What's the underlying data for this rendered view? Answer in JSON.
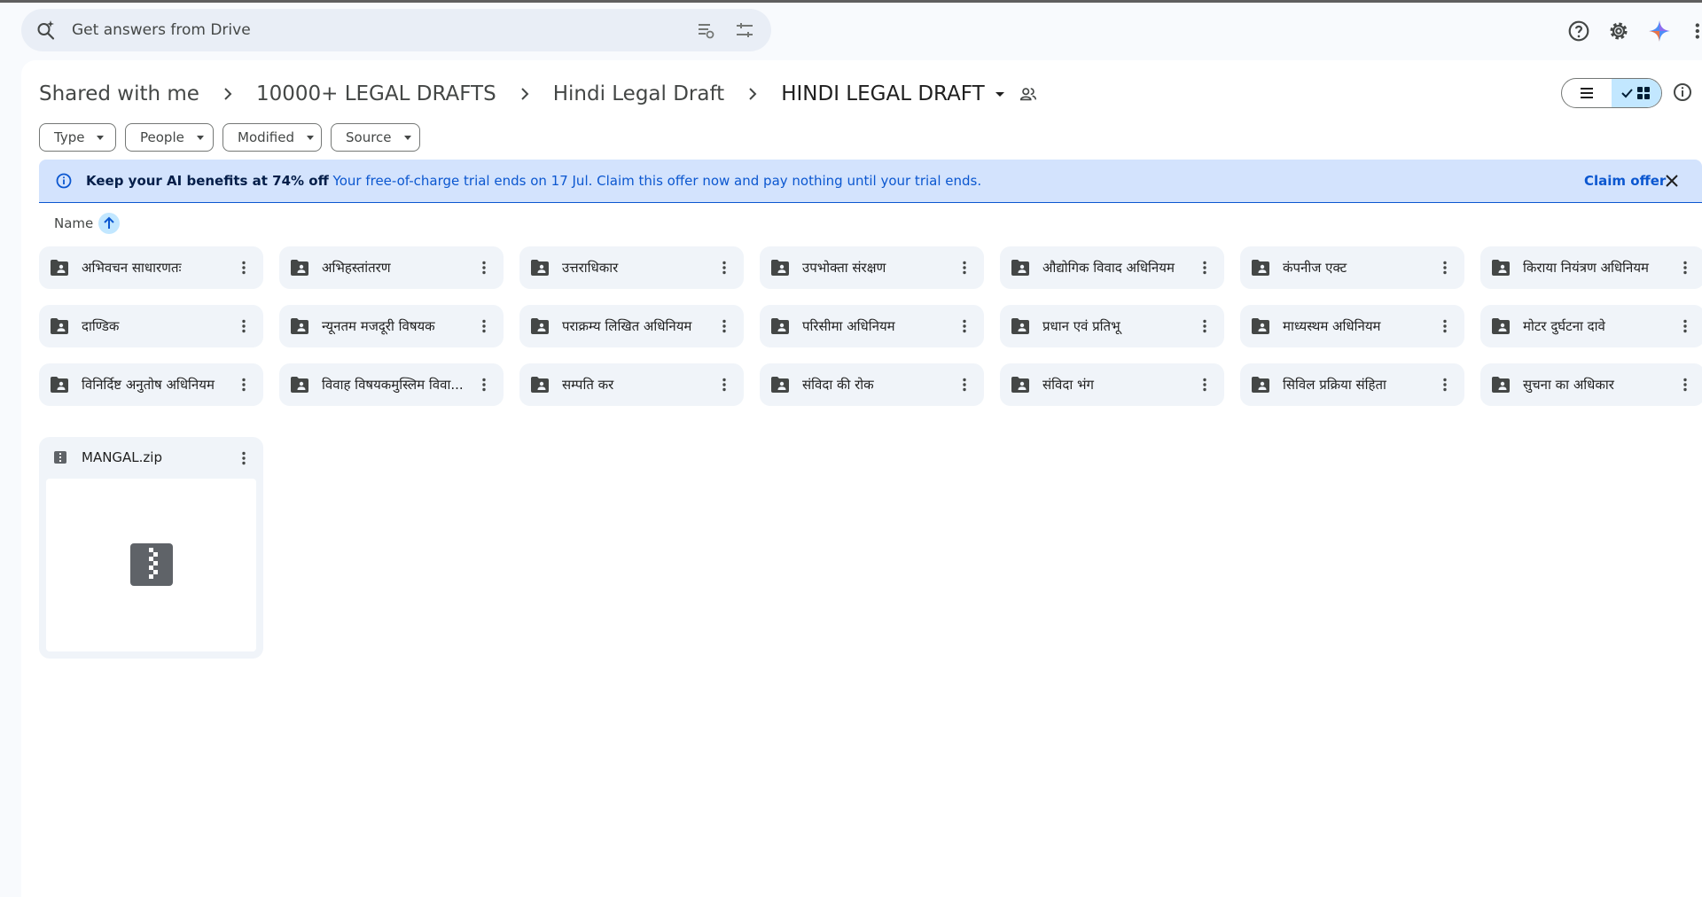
{
  "search": {
    "placeholder": "Get answers from Drive"
  },
  "breadcrumb": [
    {
      "label": "Shared with me"
    },
    {
      "label": "10000+ LEGAL DRAFTS"
    },
    {
      "label": "Hindi Legal Draft"
    },
    {
      "label": "HINDI LEGAL DRAFT"
    }
  ],
  "filters": [
    {
      "label": "Type"
    },
    {
      "label": "People"
    },
    {
      "label": "Modified"
    },
    {
      "label": "Source"
    }
  ],
  "banner": {
    "bold": "Keep your AI benefits at 74% off",
    "text": "Your free-of-charge trial ends on 17 Jul. Claim this offer now and pay nothing until your trial ends.",
    "cta": "Claim offer"
  },
  "sort": {
    "label": "Name"
  },
  "folders": [
    {
      "label": "अभिवचन साधारणतः"
    },
    {
      "label": "अभिहस्तांतरण"
    },
    {
      "label": "उत्तराधिकार"
    },
    {
      "label": "उपभोक्ता संरक्षण"
    },
    {
      "label": "औद्योगिक विवाद अधिनियम"
    },
    {
      "label": "कंपनीज एक्ट"
    },
    {
      "label": "किराया नियंत्रण अधिनियम"
    },
    {
      "label": "दाण्डिक"
    },
    {
      "label": "न्यूनतम मजदूरी विषयक"
    },
    {
      "label": "पराक्रम्य लिखित अधिनियम"
    },
    {
      "label": "परिसीमा अधिनियम"
    },
    {
      "label": "प्रधान एवं प्रतिभू"
    },
    {
      "label": "माध्यस्थम अधिनियम"
    },
    {
      "label": "मोटर दुर्घटना दावे"
    },
    {
      "label": "विनिर्दिष्ट अनुतोष अधिनियम"
    },
    {
      "label": "विवाह विषयकमुस्लिम विवा..."
    },
    {
      "label": "सम्पति कर"
    },
    {
      "label": "संविदा की रोक"
    },
    {
      "label": "संविदा भंग"
    },
    {
      "label": "सिविल प्रक्रिया संहिता"
    },
    {
      "label": "सुचना का अधिकार"
    }
  ],
  "files": [
    {
      "name": "MANGAL.zip",
      "icon": "zip-icon"
    }
  ],
  "colors": {
    "accent": "#0b57d0",
    "banner_bg": "#d3e3fd",
    "selected": "#c2e7ff",
    "folder_bg": "#f0f4f9"
  }
}
